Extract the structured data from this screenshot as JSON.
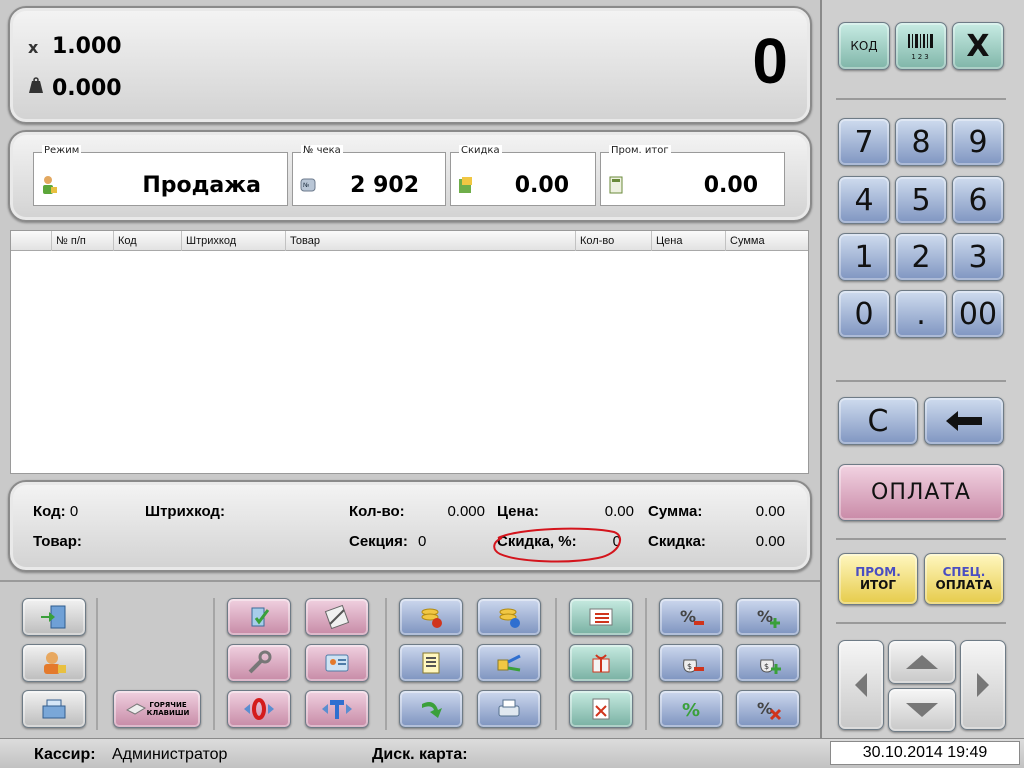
{
  "display": {
    "multiplier_symbol": "x",
    "quantity": "1.000",
    "weight": "0.000",
    "total": "0"
  },
  "info": {
    "mode_label": "Режим",
    "mode_value": "Продажа",
    "receipt_label": "№ чека",
    "receipt_value": "2 902",
    "discount_label": "Скидка",
    "discount_value": "0.00",
    "subtotal_label": "Пром. итог",
    "subtotal_value": "0.00"
  },
  "table": {
    "columns": [
      "№ п/п",
      "Код",
      "Штрихкод",
      "Товар",
      "Кол-во",
      "Цена",
      "Сумма"
    ],
    "rows": []
  },
  "item_info": {
    "code_label": "Код:",
    "code_value": "0",
    "barcode_label": "Штрихкод:",
    "barcode_value": "",
    "qty_label": "Кол-во:",
    "qty_value": "0.000",
    "price_label": "Цена:",
    "price_value": "0.00",
    "sum_label": "Сумма:",
    "sum_value": "0.00",
    "product_label": "Товар:",
    "product_value": "",
    "section_label": "Секция:",
    "section_value": "0",
    "discount_pct_label": "Скидка, %:",
    "discount_pct_value": "0",
    "discount_label": "Скидка:",
    "discount_value": "0.00"
  },
  "keypad": {
    "code_key": "КОД",
    "barcode_key": "123",
    "clear_x_key": "X",
    "digits": [
      "7",
      "8",
      "9",
      "4",
      "5",
      "6",
      "1",
      "2",
      "3",
      "0",
      ".",
      "00"
    ],
    "c_key": "C",
    "payment_key": "ОПЛАТА",
    "subtotal_key_line1": "ПРОМ.",
    "subtotal_key_line2": "ИТОГ",
    "special_pay_line1": "СПЕЦ.",
    "special_pay_line2": "ОПЛАТА"
  },
  "hotkeys_button": {
    "line1": "ГОРЯЧИЕ",
    "line2": "КЛАВИШИ"
  },
  "status": {
    "cashier_label": "Кассир:",
    "cashier_value": "Администратор",
    "card_label": "Диск. карта:",
    "card_value": "",
    "datetime": "30.10.2014 19:49"
  },
  "colors": {
    "annotation_circle": "#d4141c",
    "key_blue": "#7f95c1",
    "key_teal": "#7fb5a8",
    "key_pink": "#c98aa7",
    "key_yellow": "#e6cb4a"
  }
}
